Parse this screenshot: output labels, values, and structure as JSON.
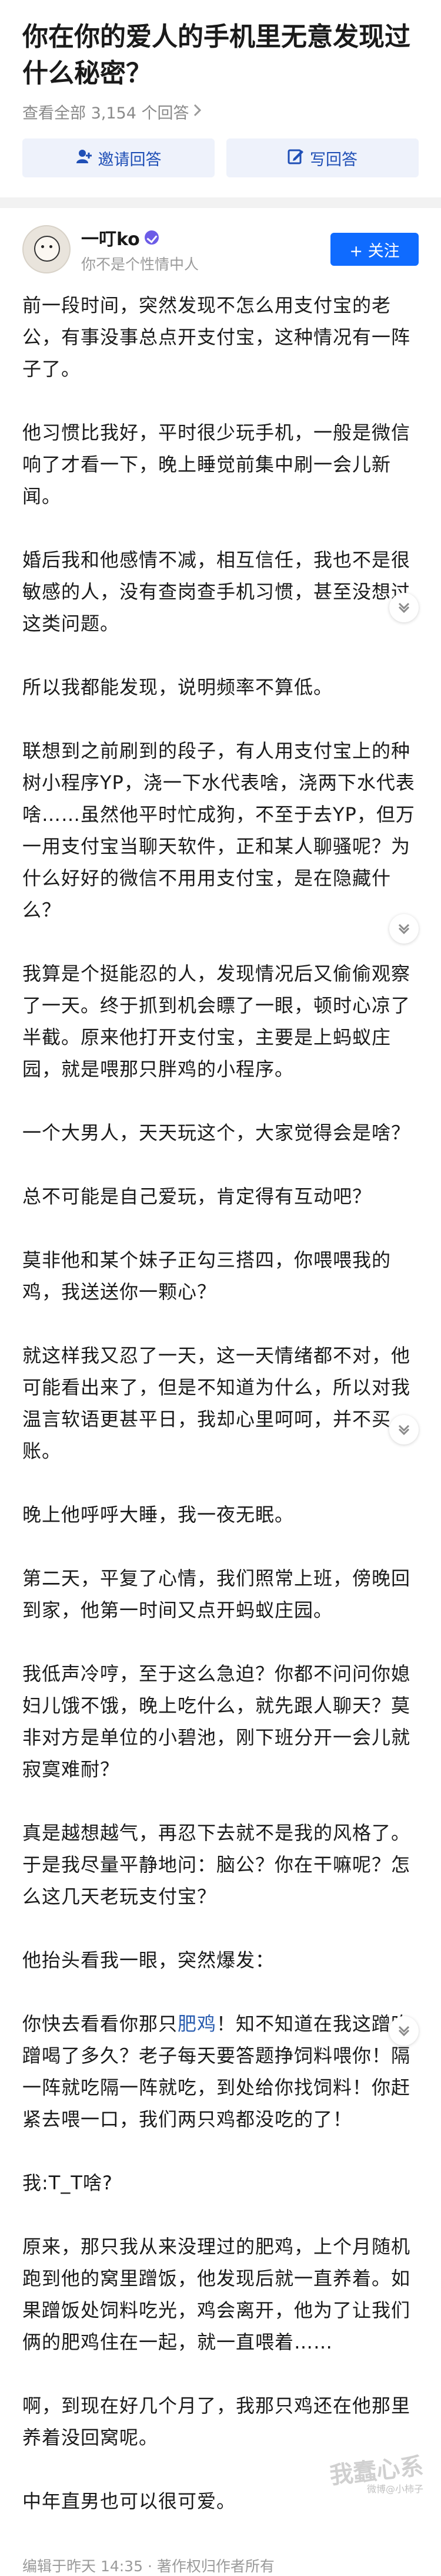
{
  "question": {
    "title": "你在你的爱人的手机里无意发现过什么秘密？",
    "view_all": "查看全部 3,154 个回答",
    "invite_label": "邀请回答",
    "write_label": "写回答"
  },
  "author": {
    "name": "一叮ko",
    "signature": "你不是个性情中人",
    "follow_label": "+ 关注"
  },
  "answer": {
    "paragraphs": [
      "前一段时间，突然发现不怎么用支付宝的老公，有事没事总点开支付宝，这种情况有一阵子了。",
      "他习惯比我好，平时很少玩手机，一般是微信响了才看一下，晚上睡觉前集中刷一会儿新闻。",
      "婚后我和他感情不减，相互信任，我也不是很敏感的人，没有查岗查手机习惯，甚至没想过这类问题。",
      "所以我都能发现，说明频率不算低。",
      "联想到之前刷到的段子，有人用支付宝上的种树小程序YP，浇一下水代表啥，浇两下水代表啥……虽然他平时忙成狗，不至于去YP，但万一用支付宝当聊天软件，正和某人聊骚呢？为什么好好的微信不用用支付宝，是在隐藏什么？",
      "我算是个挺能忍的人，发现情况后又偷偷观察了一天。终于抓到机会瞟了一眼，顿时心凉了半截。原来他打开支付宝，主要是上蚂蚁庄园，就是喂那只胖鸡的小程序。",
      "一个大男人，天天玩这个，大家觉得会是啥？",
      "总不可能是自己爱玩，肯定得有互动吧？",
      "莫非他和某个妹子正勾三搭四，你喂喂我的鸡，我送送你一颗心？",
      "就这样我又忍了一天，这一天情绪都不对，他可能看出来了，但是不知道为什么，所以对我温言软语更甚平日，我却心里呵呵，并不买账。",
      "晚上他呼呼大睡，我一夜无眠。",
      "第二天，平复了心情，我们照常上班，傍晚回到家，他第一时间又点开蚂蚁庄园。",
      "我低声冷哼，至于这么急迫？你都不问问你媳妇儿饿不饿，晚上吃什么，就先跟人聊天？莫非对方是单位的小碧池，刚下班分开一会儿就寂寞难耐？",
      "真是越想越气，再忍下去就不是我的风格了。于是我尽量平静地问：脑公？你在干嘛呢？怎么这几天老玩支付宝？",
      "他抬头看我一眼，突然爆发：",
      "你快去看看你那只肥鸡！知不知道在我这蹭吃蹭喝了多久？老子每天要答题挣饲料喂你！隔一阵就吃隔一阵就吃，到处给你找饲料！你赶紧去喂一口，我们两只鸡都没吃的了！",
      "我:T_T啥?",
      "原来，那只我从来没理过的肥鸡，上个月随机跑到他的窝里蹭饭，他发现后就一直养着。如果蹭饭处饲料吃光，鸡会离开，他为了让我们俩的肥鸡住在一起，就一直喂着……",
      "啊，到现在好几个月了，我那只鸡还在他那里养着没回窝呢。",
      "中年直男也可以很可爱。"
    ],
    "link_text": "肥鸡",
    "footer": "编辑于昨天 14:35 · 著作权归作者所有",
    "watermark": "我蠢心系",
    "watermark_sub": "微博@小柿子"
  }
}
